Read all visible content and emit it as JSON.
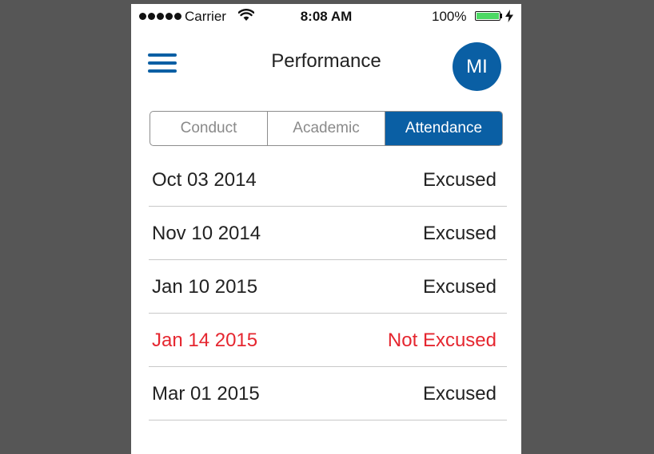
{
  "status_bar": {
    "carrier": "Carrier",
    "time": "8:08 AM",
    "battery_percent": "100%",
    "signal_bars": 5,
    "icons": [
      "signal-dots-icon",
      "wifi-icon",
      "battery-icon",
      "charging-bolt-icon"
    ]
  },
  "nav": {
    "title": "Performance",
    "avatar_initials": "MI",
    "menu_icon": "hamburger-menu-icon"
  },
  "tabs": [
    {
      "label": "Conduct",
      "active": false
    },
    {
      "label": "Academic",
      "active": false
    },
    {
      "label": "Attendance",
      "active": true
    }
  ],
  "attendance": [
    {
      "date": "Oct 03 2014",
      "status": "Excused",
      "excused": true
    },
    {
      "date": "Nov 10 2014",
      "status": "Excused",
      "excused": true
    },
    {
      "date": "Jan 10 2015",
      "status": "Excused",
      "excused": true
    },
    {
      "date": "Jan 14 2015",
      "status": "Not Excused",
      "excused": false
    },
    {
      "date": "Mar 01 2015",
      "status": "Excused",
      "excused": true
    }
  ],
  "colors": {
    "accent": "#0a5fa4",
    "alert": "#e5262f",
    "battery_fill": "#4cd964",
    "background": "#565656"
  }
}
